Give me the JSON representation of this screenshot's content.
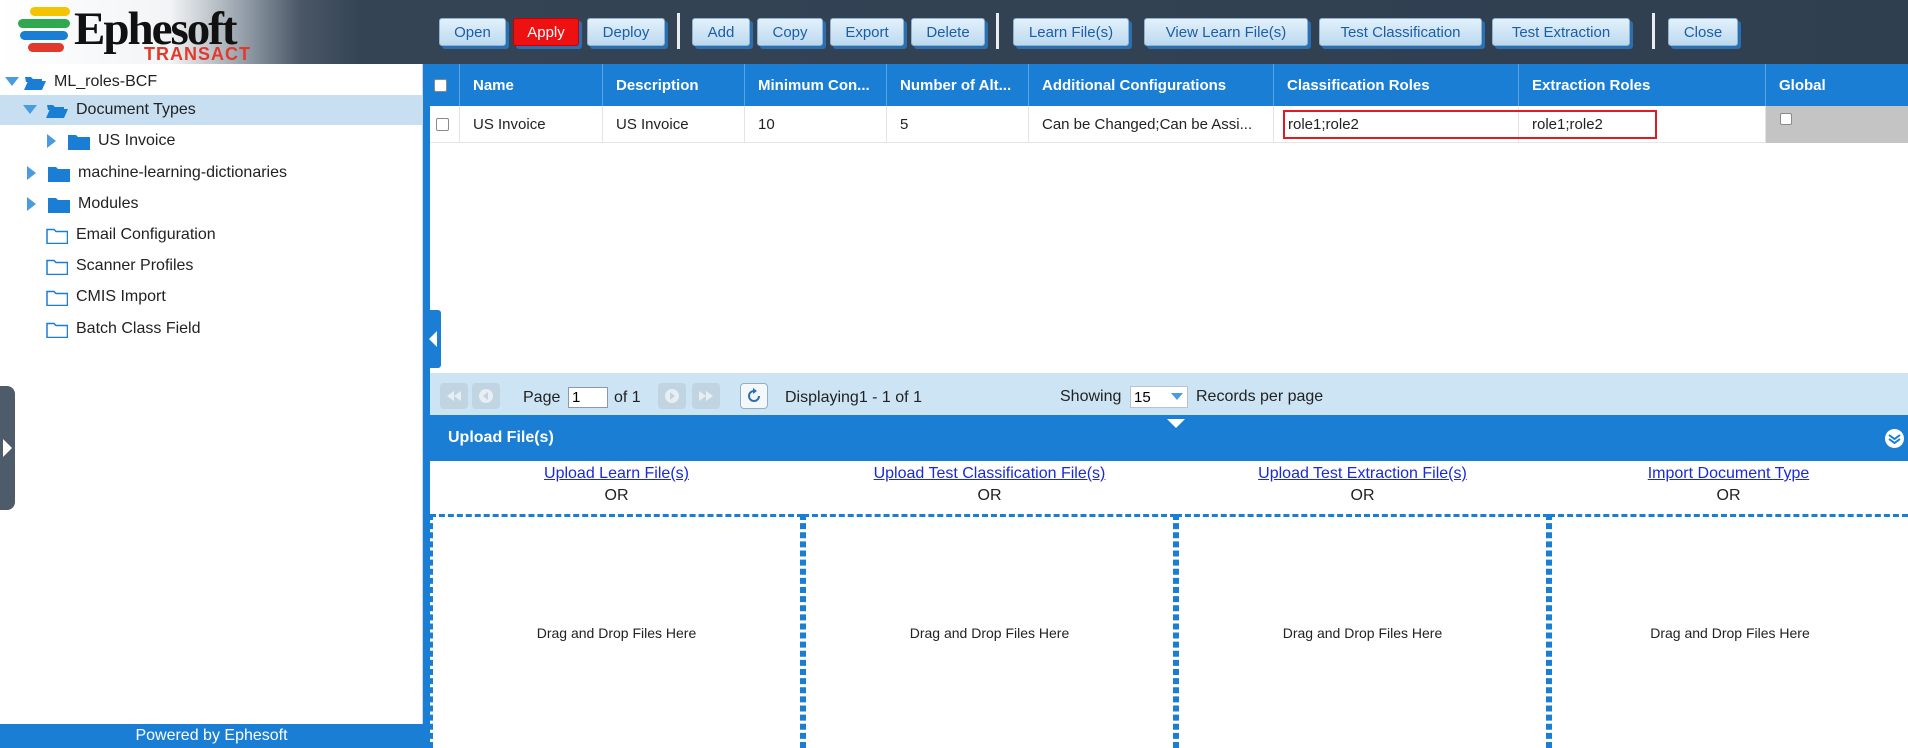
{
  "brand": {
    "name": "Ephesoft",
    "product": "TRANSACT",
    "bar_colors": [
      "#f5c400",
      "#2fa84f",
      "#1a7fd4",
      "#e23a2a"
    ]
  },
  "toolbar": {
    "open": "Open",
    "apply": "Apply",
    "deploy": "Deploy",
    "add": "Add",
    "copy": "Copy",
    "export": "Export",
    "delete": "Delete",
    "learn_files": "Learn File(s)",
    "view_learn_files": "View Learn File(s)",
    "test_classification": "Test Classification",
    "test_extraction": "Test Extraction",
    "close": "Close"
  },
  "tree": {
    "root": "ML_roles-BCF",
    "document_types": "Document Types",
    "us_invoice": "US Invoice",
    "ml_dictionaries": "machine-learning-dictionaries",
    "modules": "Modules",
    "email_configuration": "Email Configuration",
    "scanner_profiles": "Scanner Profiles",
    "cmis_import": "CMIS Import",
    "batch_class_field": "Batch Class Field"
  },
  "footer": {
    "powered_by": "Powered by Ephesoft"
  },
  "grid": {
    "columns": {
      "name": "Name",
      "description": "Description",
      "min_confidence": "Minimum Con...",
      "num_alt": "Number of Alt...",
      "additional": "Additional Configurations",
      "class_roles": "Classification Roles",
      "extr_roles": "Extraction Roles",
      "global": "Global"
    },
    "rows": [
      {
        "name": "US Invoice",
        "description": "US Invoice",
        "min_confidence": "10",
        "num_alt": "5",
        "additional": "Can be Changed;Can be Assi...",
        "class_roles": "role1;role2",
        "extr_roles": "role1;role2"
      }
    ]
  },
  "pager": {
    "page_label": "Page",
    "page_value": "1",
    "of_label": "of 1",
    "displaying": "Displaying1 - 1 of 1",
    "showing_label": "Showing",
    "page_size": "15",
    "records_label": "Records per page"
  },
  "upload": {
    "title": "Upload File(s)",
    "or": "OR",
    "drop_text": "Drag and Drop Files Here",
    "learn_link": "Upload Learn File(s)",
    "test_class_link": "Upload Test Classification File(s)",
    "test_extr_link": "Upload Test Extraction File(s)",
    "import_link": "Import Document Type"
  }
}
